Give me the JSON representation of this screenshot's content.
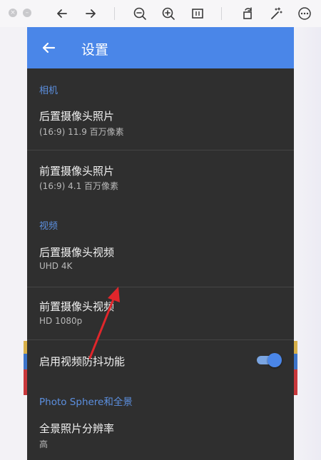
{
  "viewer": {
    "icons": [
      "close-icon",
      "minimize-icon",
      "back-arrow-icon",
      "forward-arrow-icon",
      "zoom-out-icon",
      "zoom-in-icon",
      "fit-icon",
      "rotate-icon",
      "magic-wand-icon",
      "more-icon"
    ]
  },
  "app": {
    "title": "设置",
    "accent": "#4a86e8"
  },
  "sections": {
    "camera": {
      "header": "相机"
    },
    "video": {
      "header": "视频"
    },
    "panorama": {
      "header": "Photo Sphere和全景"
    }
  },
  "items": {
    "rear_photo": {
      "title": "后置摄像头照片",
      "value": "(16:9) 11.9 百万像素"
    },
    "front_photo": {
      "title": "前置摄像头照片",
      "value": "(16:9) 4.1 百万像素"
    },
    "rear_video": {
      "title": "后置摄像头视频",
      "value": "UHD 4K"
    },
    "front_video": {
      "title": "前置摄像头视频",
      "value": "HD 1080p"
    },
    "stabilization": {
      "title": "启用视频防抖功能",
      "enabled": true
    },
    "pano_resolution": {
      "title": "全景照片分辨率",
      "value": "高"
    }
  },
  "annotation": {
    "arrow_color": "#e0262b"
  }
}
